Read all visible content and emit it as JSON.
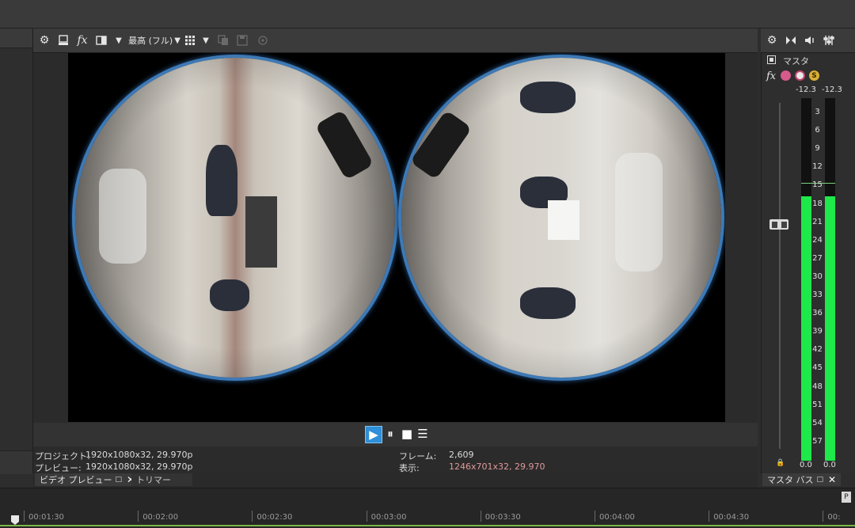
{
  "preview_toolbar": {
    "icons": [
      "gear-icon",
      "split-screen-icon",
      "fx-icon",
      "compare-icon",
      "grid-icon",
      "copy-icon",
      "save-icon",
      "external-monitor-icon"
    ],
    "quality_label": "最高 (フル)"
  },
  "transport": {
    "play": "▶",
    "pause": "⏸",
    "stop": "■",
    "menu": "☰"
  },
  "info": {
    "project_label": "プロジェクト:",
    "project_value": "1920x1080x32, 29.970p",
    "preview_label": "プレビュー:",
    "preview_value": "1920x1080x32, 29.970p",
    "frame_label": "フレーム:",
    "frame_value": "2,609",
    "display_label": "表示:",
    "display_value": "1246x701x32, 29.970"
  },
  "tabs": {
    "video_preview": "ビデオ プレビュー",
    "trimmer": "トリマー",
    "master_bus": "マスタ バス"
  },
  "mixer": {
    "master_label": "マスタ",
    "peak_left": "-12.3",
    "peak_right": "-12.3",
    "scale": [
      "3",
      "6",
      "9",
      "12",
      "15",
      "18",
      "21",
      "24",
      "27",
      "30",
      "33",
      "36",
      "39",
      "42",
      "45",
      "48",
      "51",
      "54",
      "57"
    ],
    "level_left": "0.0",
    "level_right": "0.0",
    "meter_fill_fraction": 0.73,
    "meter_color": "#1fe84a"
  },
  "timeline": {
    "marks": [
      "00:01:30",
      "00:02:00",
      "00:02:30",
      "00:03:00",
      "00:03:30",
      "00:04:00",
      "00:04:30",
      "00:"
    ]
  }
}
